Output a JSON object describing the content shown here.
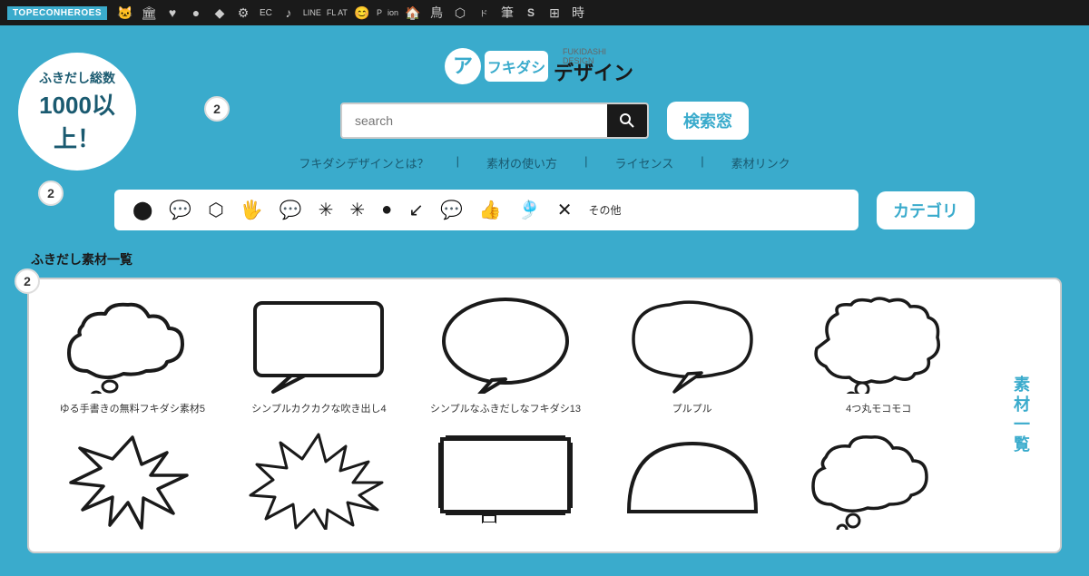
{
  "topnav": {
    "brand": "TOPECONHEROES",
    "icons": [
      "🐱",
      "🏛",
      "♥",
      "●",
      "●",
      "⚙",
      "EC",
      "♪",
      "LINE",
      "FL AT",
      "😊",
      "P",
      "ion",
      "🏠",
      "🐦",
      "⬡",
      "ド",
      "筆",
      "S",
      "⊞",
      "時"
    ]
  },
  "topleft": {
    "line1": "ふきだし総数",
    "line2": "1000以上！"
  },
  "logo": {
    "icon": "ア",
    "text_jp": "フキダシ",
    "text_design": "デザイン"
  },
  "search": {
    "placeholder": "search",
    "badge_number": "2",
    "label": "検索窓"
  },
  "navlinks": [
    {
      "label": "フキダシデザインとは？"
    },
    {
      "label": "素材の使い方"
    },
    {
      "label": "ライセンス"
    },
    {
      "label": "素材リンク"
    }
  ],
  "category": {
    "badge_number": "2",
    "label": "カテゴリ",
    "items": [
      "●",
      "💬",
      "⬡",
      "🖐",
      "💬",
      "✳",
      "✳",
      "●",
      "↙",
      "💬",
      "👍",
      "🎐",
      "✗",
      "その他"
    ]
  },
  "fukidashi": {
    "section_title": "ふきだし素材一覧",
    "badge_number": "2",
    "label": "素材一覧",
    "row1": [
      {
        "label": "ゆる手書きの無料フキダシ素材5",
        "type": "cloud"
      },
      {
        "label": "シンプルカクカクな吹き出し4",
        "type": "rect"
      },
      {
        "label": "シンプルなふきだしなフキダシ13",
        "type": "circle"
      },
      {
        "label": "プルプル",
        "type": "purupuru"
      },
      {
        "label": "4つ丸モコモコ",
        "type": "mokomoko"
      }
    ],
    "row2": [
      {
        "label": "",
        "type": "burst"
      },
      {
        "label": "",
        "type": "spiky"
      },
      {
        "label": "",
        "type": "pixel"
      },
      {
        "label": "",
        "type": "halfcircle"
      },
      {
        "label": "",
        "type": "cloud2"
      }
    ]
  }
}
